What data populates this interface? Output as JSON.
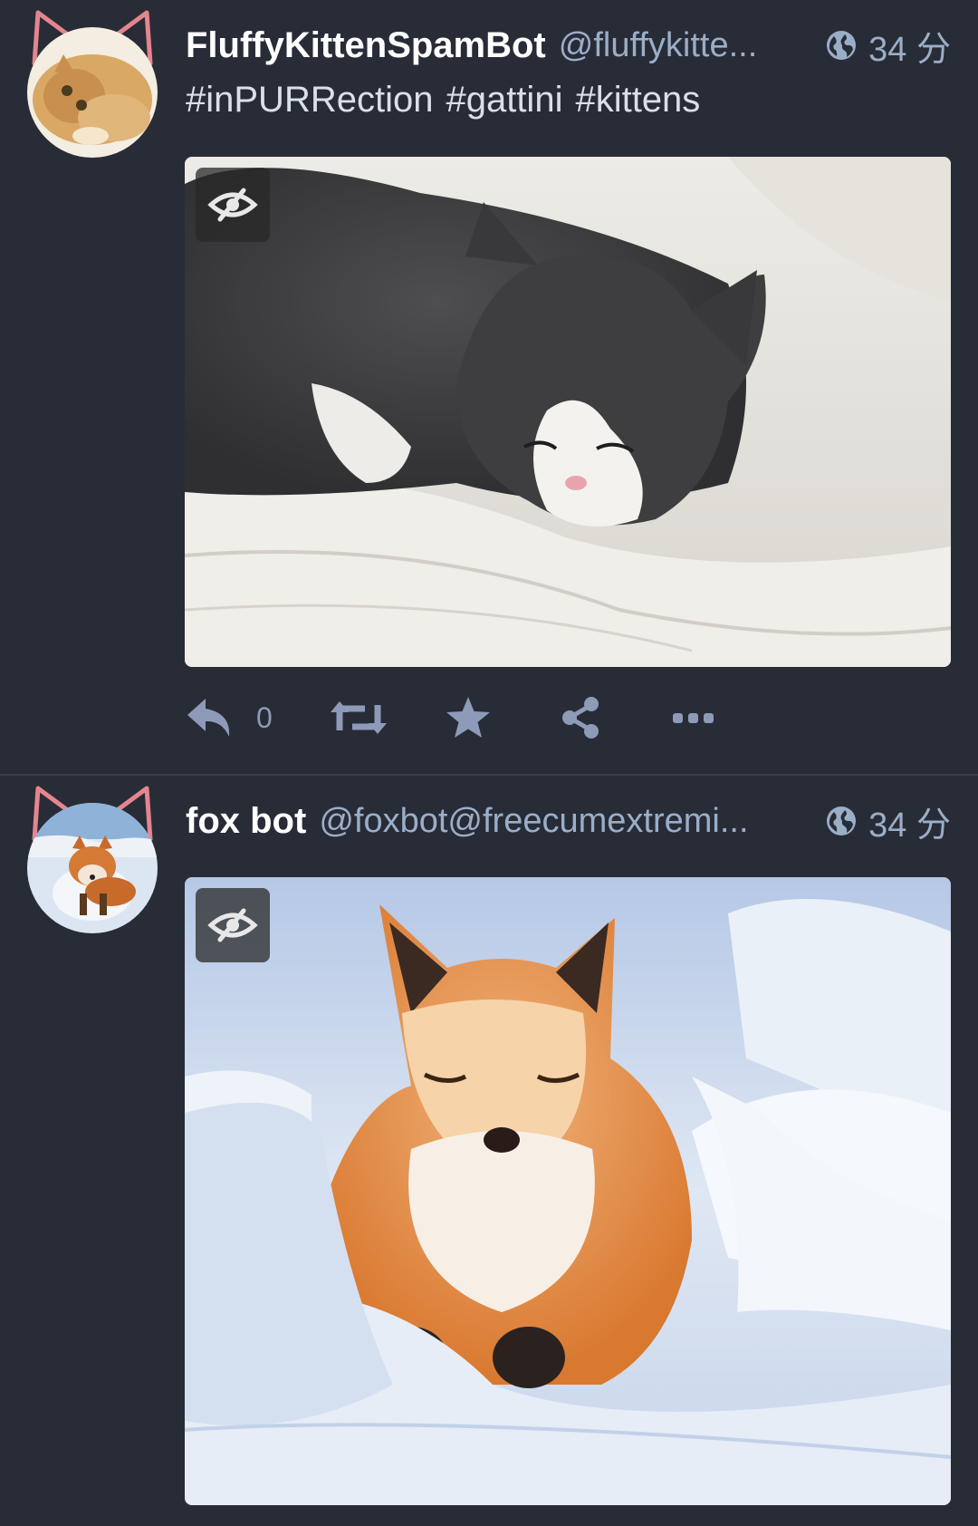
{
  "colors": {
    "background": "#282c37",
    "display_name": "#ffffff",
    "secondary_text": "#9baec8",
    "action_icon": "#8d9ab8",
    "divider": "#393f4f",
    "cat_ears": "#e5858e"
  },
  "statuses": [
    {
      "display_name": "FluffyKittenSpamBot",
      "acct": "@fluffykitte...",
      "visibility_icon": "globe-icon",
      "timestamp": "34 分",
      "hashtags": [
        "#inPURRection",
        "#gattini",
        "#kittens"
      ],
      "media_icon": "eye-slash-icon",
      "actions": {
        "reply_icon": "reply-icon",
        "reply_count": "0",
        "boost_icon": "retweet-icon",
        "favourite_icon": "star-icon",
        "share_icon": "share-icon",
        "more_icon": "ellipsis-icon"
      }
    },
    {
      "display_name": "fox bot",
      "acct": "@foxbot@freecumextremi...",
      "visibility_icon": "globe-icon",
      "timestamp": "34 分",
      "media_icon": "eye-slash-icon"
    }
  ]
}
